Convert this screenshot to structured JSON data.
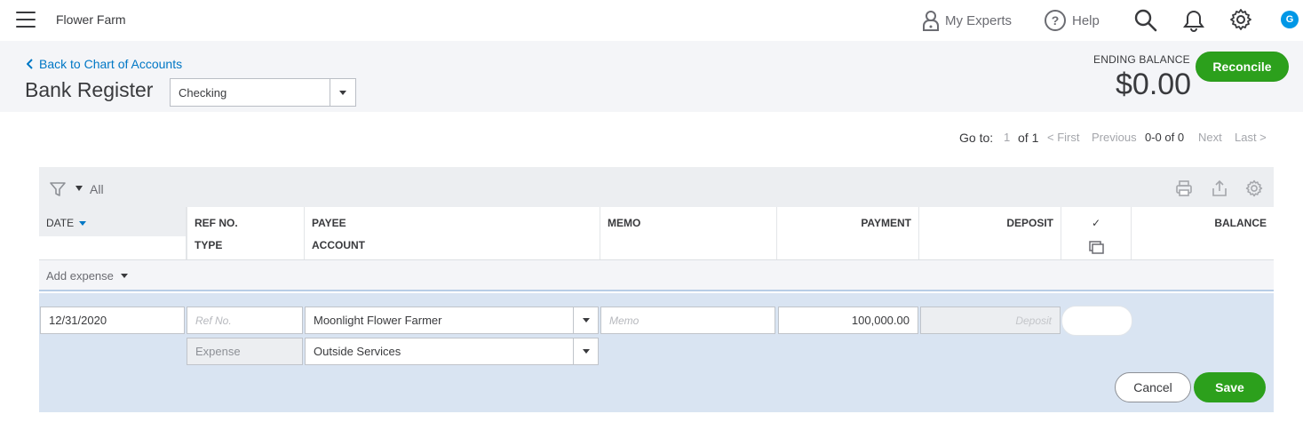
{
  "topnav": {
    "company": "Flower Farm",
    "my_experts": "My Experts",
    "help": "Help",
    "avatar_initial": "G",
    "icons": [
      "menu-icon",
      "person-icon",
      "help-icon",
      "search-icon",
      "bell-icon",
      "gear-icon"
    ]
  },
  "header": {
    "back_link": "Back to Chart of Accounts",
    "title": "Bank Register",
    "account_selected": "Checking",
    "ending_balance_label": "ENDING BALANCE",
    "ending_balance_value": "$0.00",
    "reconcile_label": "Reconcile"
  },
  "pager": {
    "goto_label": "Go to:",
    "page": "1",
    "of_label": "of 1",
    "first": "< First",
    "previous": "Previous",
    "range": "0-0 of 0",
    "next": "Next",
    "last": "Last >"
  },
  "register": {
    "filter_label": "All",
    "columns": {
      "date": "DATE",
      "ref_no": "REF NO.",
      "type": "TYPE",
      "payee": "PAYEE",
      "account": "ACCOUNT",
      "memo": "MEMO",
      "payment": "PAYMENT",
      "deposit": "DEPOSIT",
      "cleared": "✓",
      "balance": "BALANCE"
    },
    "add_expense_label": "Add expense",
    "edit_row": {
      "date": "12/31/2020",
      "ref_no_placeholder": "Ref No.",
      "type": "Expense",
      "payee": "Moonlight Flower Farmer",
      "account": "Outside Services",
      "memo_placeholder": "Memo",
      "payment": "100,000.00",
      "deposit_placeholder": "Deposit",
      "cancel_label": "Cancel",
      "save_label": "Save"
    }
  },
  "colors": {
    "brand_green": "#2ca01c",
    "link_blue": "#0077c5",
    "edit_bg": "#d9e4f2"
  }
}
